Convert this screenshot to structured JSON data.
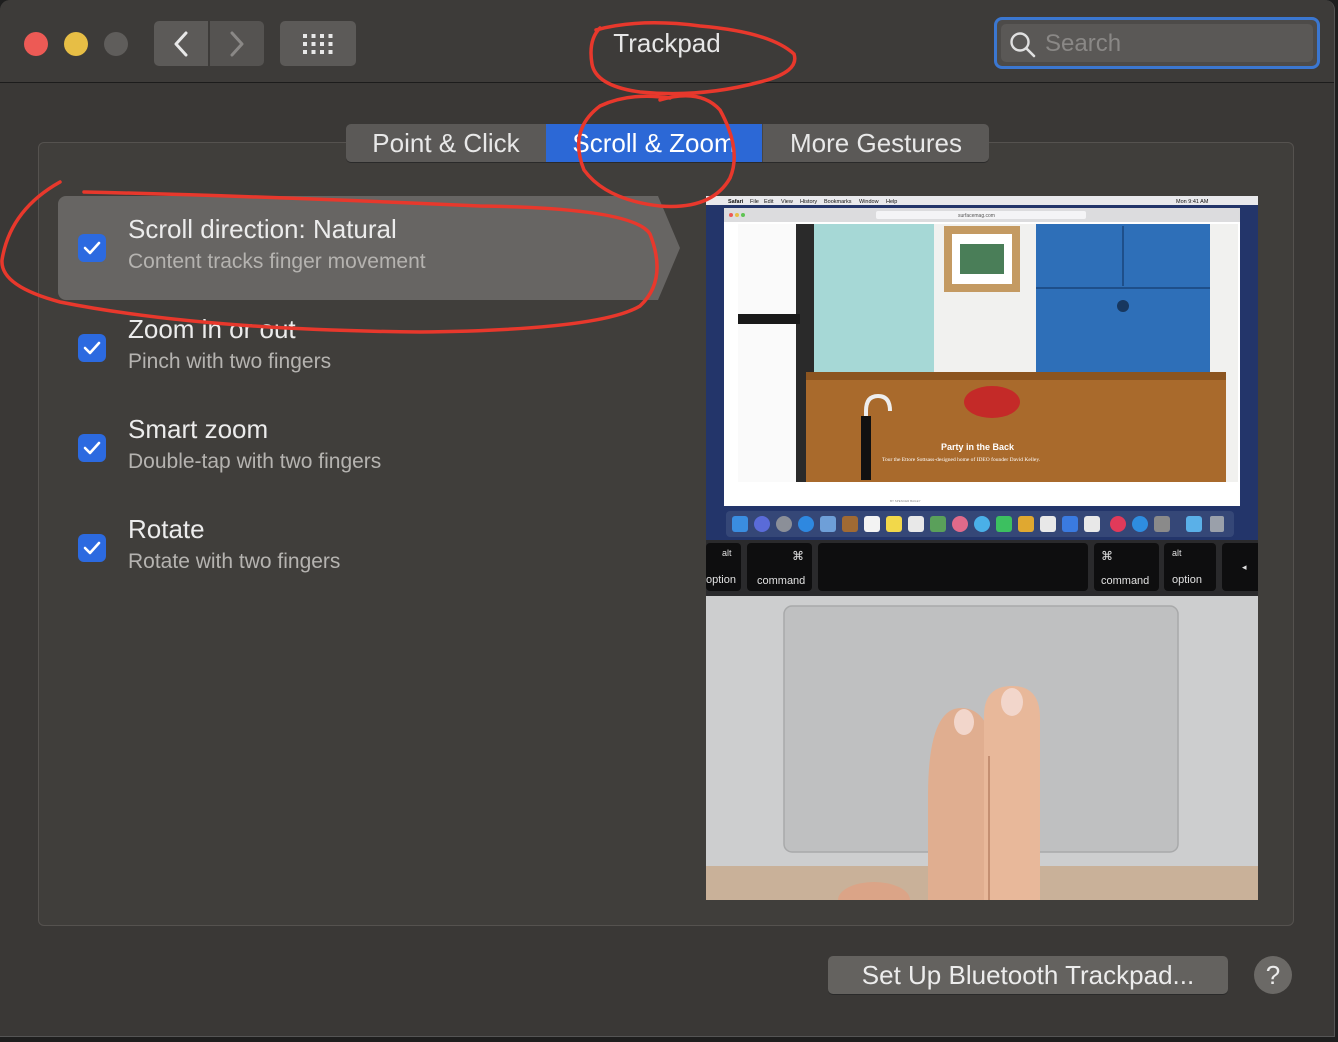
{
  "window": {
    "title": "Trackpad"
  },
  "toolbar": {
    "back_icon": "chevron-left-icon",
    "forward_icon": "chevron-right-icon",
    "show_all_icon": "grid-icon"
  },
  "search": {
    "placeholder": "Search",
    "icon": "search-icon"
  },
  "tabs": [
    {
      "label": "Point & Click",
      "selected": false
    },
    {
      "label": "Scroll & Zoom",
      "selected": true
    },
    {
      "label": "More Gestures",
      "selected": false
    }
  ],
  "options": [
    {
      "label": "Scroll direction: Natural",
      "description": "Content tracks finger movement",
      "checked": true,
      "selected": true
    },
    {
      "label": "Zoom in or out",
      "description": "Pinch with two fingers",
      "checked": true,
      "selected": false
    },
    {
      "label": "Smart zoom",
      "description": "Double-tap with two fingers",
      "checked": true,
      "selected": false
    },
    {
      "label": "Rotate",
      "description": "Rotate with two fingers",
      "checked": true,
      "selected": false
    }
  ],
  "preview": {
    "menubar": [
      "Safari",
      "File",
      "Edit",
      "View",
      "History",
      "Bookmarks",
      "Window",
      "Help"
    ],
    "clock": "Mon 9:41 AM",
    "url": "surfacemag.com",
    "article_title": "Party in the Back",
    "article_sub": "Tour the Ettore Sottsass-designed home of IDEO founder David Kelley.",
    "byline": "BY SPENCER BAILEY",
    "keys": {
      "alt_left": "alt",
      "option_left": "option",
      "cmd_symbol": "⌘",
      "command_left": "command",
      "command_right": "command",
      "alt_right": "alt",
      "option_right": "option",
      "arrow": "◂"
    }
  },
  "footer": {
    "setup_button": "Set Up Bluetooth Trackpad...",
    "help_button": "?"
  },
  "colors": {
    "accent": "#2c68d6",
    "annotation": "#e8382c"
  }
}
